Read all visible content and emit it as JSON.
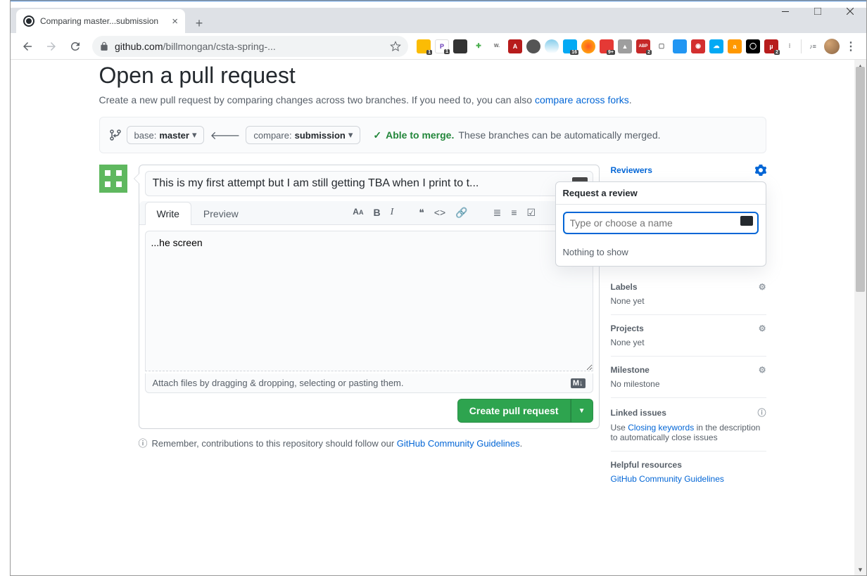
{
  "window": {
    "tab_title": "Comparing master...submission",
    "url_domain": "github.com",
    "url_path": "/billmongan/csta-spring-..."
  },
  "page": {
    "title": "Open a pull request",
    "subhead_text": "Create a new pull request by comparing changes across two branches. If you need to, you can also ",
    "subhead_link": "compare across forks"
  },
  "branches": {
    "base_label": "base: ",
    "base_value": "master",
    "compare_label": "compare: ",
    "compare_value": "submission",
    "able_text": "Able to merge.",
    "able_sub": "These branches can be automatically merged."
  },
  "form": {
    "title_value": "This is my first attempt but I am still getting TBA when I print to t...",
    "write_tab": "Write",
    "preview_tab": "Preview",
    "body_value": "...he screen",
    "attach_text": "Attach files by dragging & dropping, selecting or pasting them.",
    "submit_label": "Create pull request",
    "remember_text": "Remember, contributions to this repository should follow our ",
    "remember_link": "GitHub Community Guidelines"
  },
  "sidebar": {
    "reviewers": {
      "title": "Reviewers"
    },
    "labels": {
      "title": "Labels",
      "body": "None yet"
    },
    "projects": {
      "title": "Projects",
      "body": "None yet"
    },
    "milestone": {
      "title": "Milestone",
      "body": "No milestone"
    },
    "linked": {
      "title": "Linked issues",
      "body_pre": "Use ",
      "body_link": "Closing keywords",
      "body_post": " in the description to automatically close issues"
    },
    "helpful": {
      "title": "Helpful resources",
      "link": "GitHub Community Guidelines"
    }
  },
  "popover": {
    "title": "Request a review",
    "placeholder": "Type or choose a name",
    "empty": "Nothing to show"
  }
}
